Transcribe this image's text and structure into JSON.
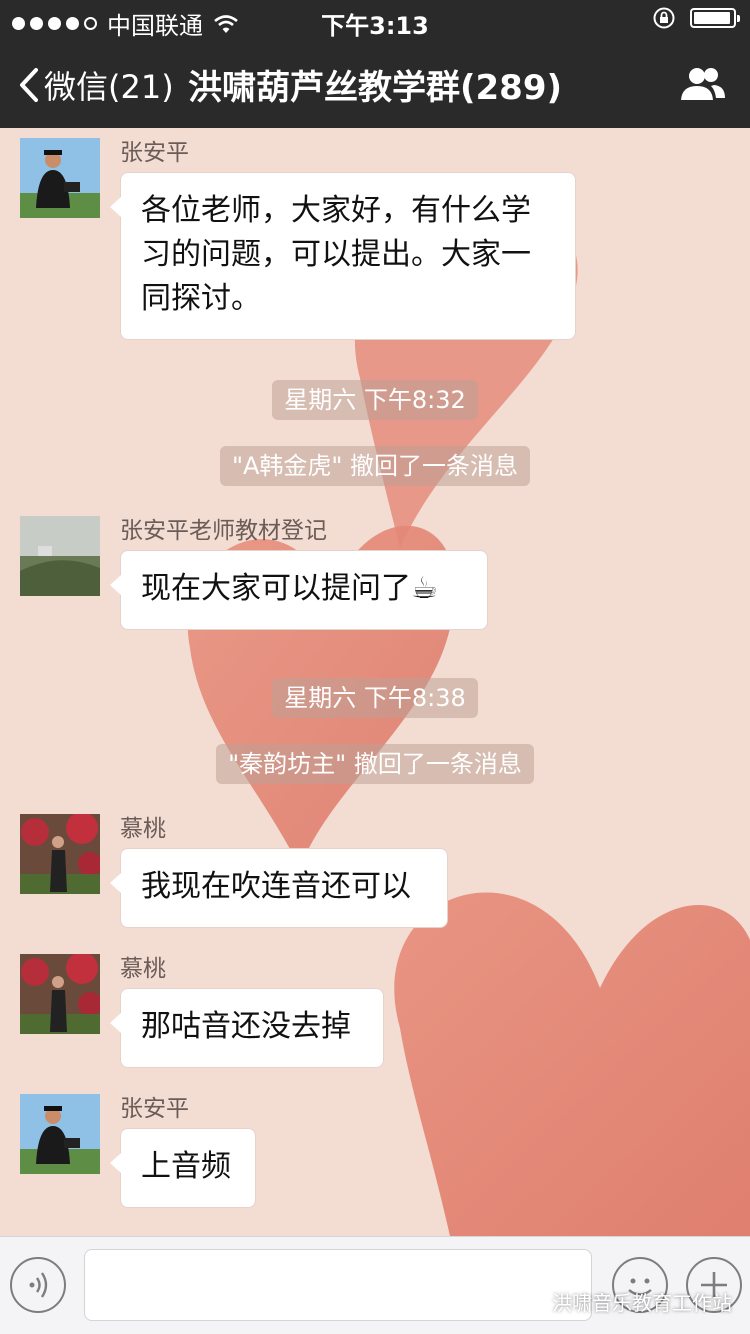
{
  "status_bar": {
    "carrier": "中国联通",
    "time": "下午3:13",
    "signal_bars": 4,
    "battery_level": 0.95
  },
  "nav": {
    "back_label": "微信(21)",
    "title": "洪啸葫芦丝教学群(289)"
  },
  "messages": [
    {
      "sender": "张安平",
      "text": "各位老师，大家好，有什么学习的问题，可以提出。大家一同探讨。",
      "avatar": "person-with-camera"
    },
    {
      "system": "星期六 下午8:32"
    },
    {
      "system": "\"A韩金虎\" 撤回了一条消息"
    },
    {
      "sender": "张安平老师教材登记",
      "text": "现在大家可以提问了☕",
      "avatar": "misty-landscape"
    },
    {
      "system": "星期六 下午8:38"
    },
    {
      "system": "\"秦韵坊主\" 撤回了一条消息"
    },
    {
      "sender": "慕桃",
      "text": "我现在吹连音还可以",
      "avatar": "person-with-red-blossoms"
    },
    {
      "sender": "慕桃",
      "text": "那咕音还没去掉",
      "avatar": "person-with-red-blossoms"
    },
    {
      "sender": "张安平",
      "text": "上音频",
      "avatar": "person-with-camera"
    }
  ],
  "toolbar": {
    "watermark": "洪啸音乐教育工作站"
  },
  "colors": {
    "bar_bg": "#2a2a2a",
    "chat_bg": "#f3ddd3",
    "heart": "#e07f6f"
  }
}
